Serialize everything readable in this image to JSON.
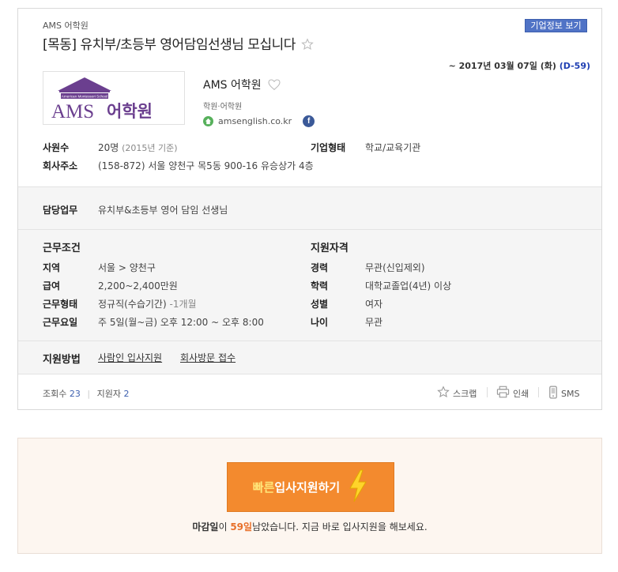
{
  "header": {
    "company_small": "AMS 어학원",
    "corp_info_button": "기업정보 보기",
    "title": "[목동] 유치부/초등부 영어담임선생님 모십니다",
    "deadline_prefix": "~ 2017년 03월 07일 (화)",
    "dday": "(D-59)"
  },
  "company": {
    "logo_top": "American Montessori School",
    "logo_main": "AMS",
    "logo_kor": "어학원",
    "name": "AMS 어학원",
    "category": "학원·어학원",
    "website": "amsenglish.co.kr",
    "facebook_letter": "f"
  },
  "info": {
    "employees_label": "사원수",
    "employees_value": "20명",
    "employees_note": "(2015년 기준)",
    "type_label": "기업형태",
    "type_value": "학교/교육기관",
    "address_label": "회사주소",
    "address_value": "(158-872) 서울 양천구 목5동 900-16 유승상가 4층"
  },
  "duty": {
    "label": "담당업무",
    "value": "유치부&초등부 영어 담임 선생님"
  },
  "conditions": {
    "heading": "근무조건",
    "rows": [
      {
        "label": "지역",
        "value": "서울 > 양천구",
        "note": ""
      },
      {
        "label": "급여",
        "value": "2,200~2,400만원",
        "note": ""
      },
      {
        "label": "근무형태",
        "value": "정규직(수습기간)",
        "note": "-1개월"
      },
      {
        "label": "근무요일",
        "value": "주 5일(월~금) 오후 12:00 ~ 오후 8:00",
        "note": ""
      }
    ]
  },
  "qualifications": {
    "heading": "지원자격",
    "rows": [
      {
        "label": "경력",
        "value": "무관(신입제외)"
      },
      {
        "label": "학력",
        "value": "대학교졸업(4년) 이상"
      },
      {
        "label": "성별",
        "value": "여자"
      },
      {
        "label": "나이",
        "value": "무관"
      }
    ]
  },
  "apply_method": {
    "label": "지원방법",
    "option1": "사람인 입사지원",
    "option2": "회사방문 접수"
  },
  "stats": {
    "views_label": "조회수",
    "views": "23",
    "applicants_label": "지원자",
    "applicants": "2"
  },
  "actions": {
    "scrap": "스크랩",
    "print": "인쇄",
    "sms": "SMS"
  },
  "apply": {
    "button_highlight": "빠른",
    "button_rest": "입사지원하기",
    "msg_bold": "마감일",
    "msg_pre": "이 ",
    "msg_days": "59일",
    "msg_post": "남았습니다. 지금 바로 입사지원을 해보세요."
  },
  "colors": {
    "accent_blue": "#5073c6",
    "orange": "#f38a2e",
    "logo_purple": "#6b3f8f"
  }
}
